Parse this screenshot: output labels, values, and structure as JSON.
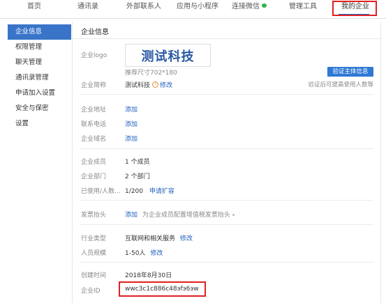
{
  "nav": {
    "tabs": [
      {
        "label": "首页"
      },
      {
        "label": "通讯录"
      },
      {
        "label": "外部联系人"
      },
      {
        "label": "应用与小程序"
      },
      {
        "label": "连接微信"
      },
      {
        "label": "管理工具"
      },
      {
        "label": "我的企业"
      }
    ],
    "active_index": 6,
    "highlight_color": "#e02020",
    "accent_color": "#1c6ad7"
  },
  "sidebar": {
    "items": [
      {
        "label": "企业信息"
      },
      {
        "label": "权限管理"
      },
      {
        "label": "聊天管理"
      },
      {
        "label": "通讯录管理"
      },
      {
        "label": "申请加入设置"
      },
      {
        "label": "安全与保密"
      },
      {
        "label": "设置"
      }
    ],
    "active_index": 0,
    "active_color": "#3974c9"
  },
  "panel": {
    "title": "企业信息",
    "logo": {
      "label": "企业logo",
      "logo_text": "测试科技",
      "size_hint": "推荐尺寸702*180"
    },
    "verify_button": "验证主体信息",
    "short_name": {
      "label": "企业简称",
      "value": "测试科技",
      "edit": "修改",
      "note": "验证后可提高使用人数等"
    },
    "address": {
      "label": "企业地址",
      "action": "添加"
    },
    "phone": {
      "label": "联系电话",
      "action": "添加"
    },
    "domain": {
      "label": "企业域名",
      "action": "添加"
    },
    "members": {
      "label": "企业成员",
      "value": "1 个成员"
    },
    "departments": {
      "label": "企业部门",
      "value": "2 个部门"
    },
    "usage": {
      "label": "已使用/人数...",
      "value": "1/200",
      "action": "申请扩容"
    },
    "invoice": {
      "label": "发票抬头",
      "action": "添加",
      "desc": "为企业成员配置增值税发票抬头"
    },
    "industry": {
      "label": "行业类型",
      "value": "互联网和相关服务",
      "edit": "修改"
    },
    "size": {
      "label": "人员规模",
      "value": "1-50人",
      "edit": "修改"
    },
    "created": {
      "label": "创建时间",
      "value": "2018年8月30日"
    },
    "corp_id": {
      "label": "企业ID",
      "value": "wwc3c1c886c48эfэ6эw"
    }
  }
}
